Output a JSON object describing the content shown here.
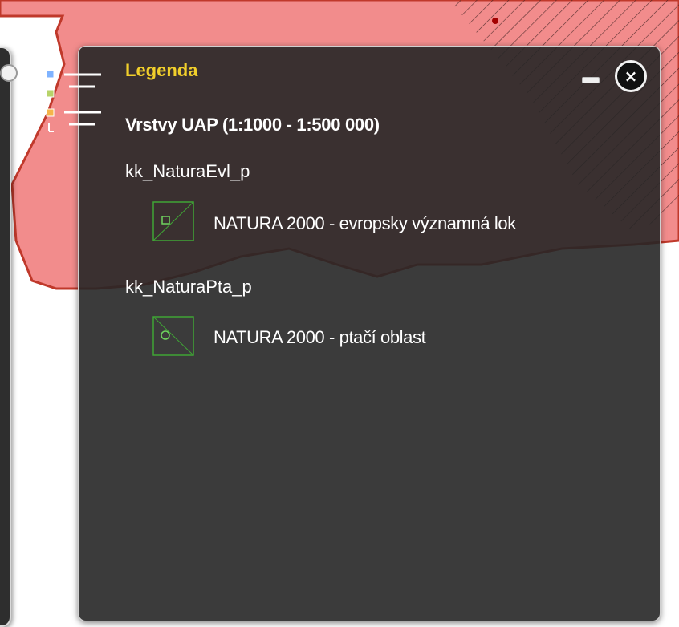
{
  "colors": {
    "map_fill": "#f28c8c",
    "map_stroke": "#c0392b",
    "panel_bg": "#262626",
    "title_accent": "#f1cf2b",
    "symbol_stroke": "#3fa535"
  },
  "legend": {
    "title": "Legenda",
    "group_title": "Vrstvy UAP  (1:1000 - 1:500 000)",
    "layers": [
      {
        "name": "kk_NaturaEvl_p",
        "symbol": "hatched-square-symbol",
        "item_label": "NATURA 2000 - evropsky významná lok"
      },
      {
        "name": "kk_NaturaPta_p",
        "symbol": "hatched-circle-symbol",
        "item_label": "NATURA 2000 - ptačí oblast"
      }
    ]
  },
  "icons": {
    "legend_tab": "legend-list-icon",
    "minimize": "minimize-icon",
    "close": "close-icon"
  }
}
